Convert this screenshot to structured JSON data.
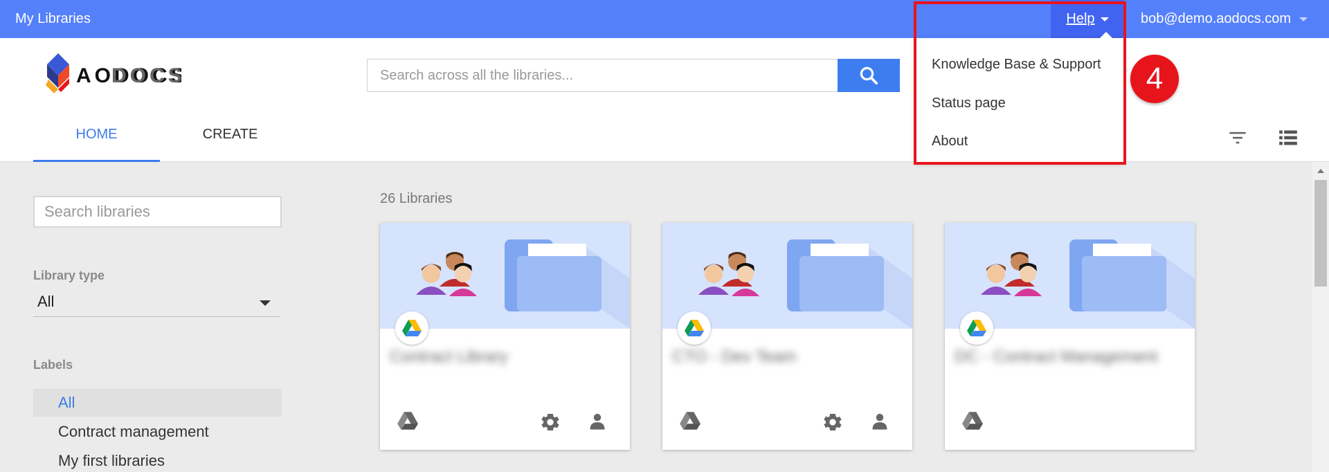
{
  "topbar": {
    "app_title": "My Libraries",
    "help_label": "Help",
    "user_email": "bob@demo.aodocs.com",
    "color": "#5580fb"
  },
  "header": {
    "logo_text": "AODOCS",
    "search_placeholder": "Search across all the libraries...",
    "tabs": [
      {
        "label": "HOME",
        "active": true
      },
      {
        "label": "CREATE",
        "active": false
      }
    ]
  },
  "help_menu": {
    "items": [
      "Knowledge Base & Support",
      "Status page",
      "About"
    ],
    "step_badge": "4"
  },
  "sidebar": {
    "search_placeholder": "Search libraries",
    "library_type_label": "Library type",
    "library_type_value": "All",
    "labels_heading": "Labels",
    "labels": [
      {
        "label": "All",
        "active": true
      },
      {
        "label": "Contract management",
        "active": false
      },
      {
        "label": "My first libraries",
        "active": false
      }
    ]
  },
  "main": {
    "library_count": "26 Libraries",
    "cards": [
      {
        "title": "Contract Library",
        "has_settings": true,
        "has_user": true
      },
      {
        "title": "CTO - Dev Team",
        "has_settings": true,
        "has_user": true
      },
      {
        "title": "DC - Contract Management",
        "has_settings": false,
        "has_user": false
      }
    ]
  },
  "colors": {
    "accent": "#3c7ce8",
    "highlight": "#e8141c"
  }
}
